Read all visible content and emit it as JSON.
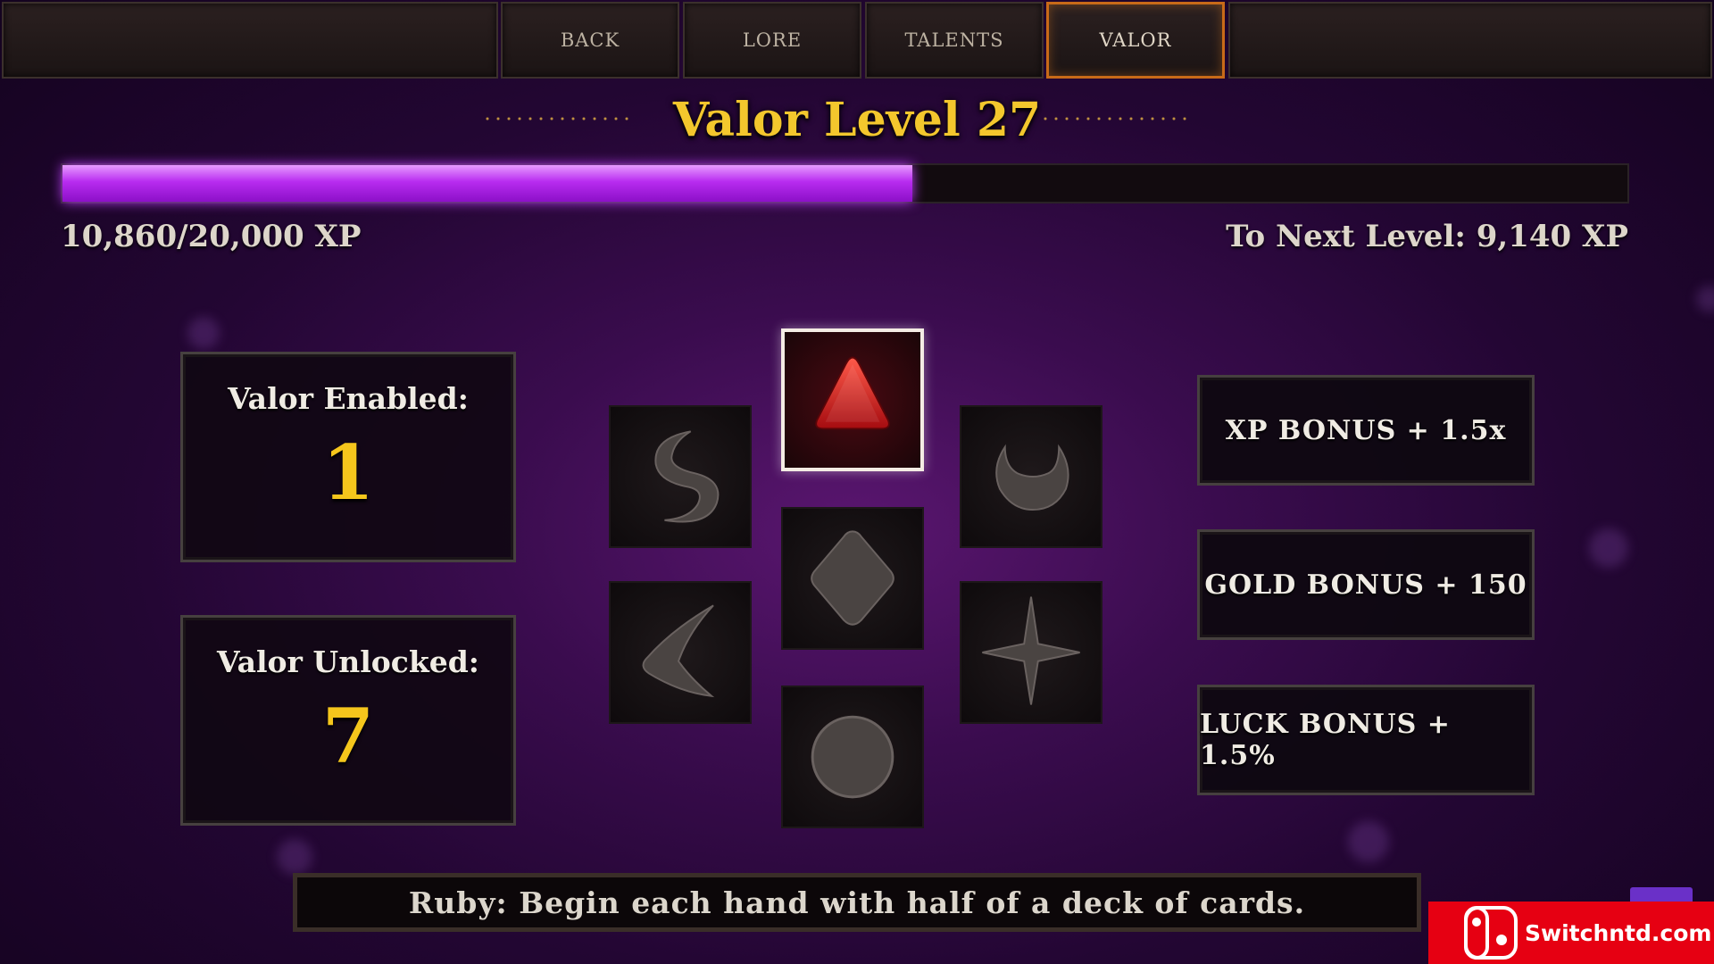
{
  "nav": {
    "tabs": [
      {
        "label": "BACK",
        "active": false
      },
      {
        "label": "LORE",
        "active": false
      },
      {
        "label": "TALENTS",
        "active": false
      },
      {
        "label": "VALOR",
        "active": true
      }
    ]
  },
  "header": {
    "title": "Valor Level 27"
  },
  "xp": {
    "progress_text": "10,860/20,000 XP",
    "to_next_text": "To Next Level: 9,140 XP",
    "current": 10860,
    "max": 20000
  },
  "stats": {
    "enabled_label": "Valor Enabled:",
    "enabled_value": "1",
    "unlocked_label": "Valor Unlocked:",
    "unlocked_value": "7"
  },
  "gems": [
    {
      "name": "ruby",
      "icon": "red-triangle-gem-icon",
      "selected": true
    },
    {
      "name": "crescent-s",
      "icon": "s-crescent-gem-icon",
      "selected": false
    },
    {
      "name": "horn",
      "icon": "horned-crescent-gem-icon",
      "selected": false
    },
    {
      "name": "diamond",
      "icon": "diamond-gem-icon",
      "selected": false
    },
    {
      "name": "chevron",
      "icon": "chevron-gem-icon",
      "selected": false
    },
    {
      "name": "star",
      "icon": "four-point-star-gem-icon",
      "selected": false
    },
    {
      "name": "circle",
      "icon": "circle-gem-icon",
      "selected": false
    }
  ],
  "bonuses": {
    "xp": "XP BONUS + 1.5x",
    "gold": "GOLD BONUS + 150",
    "luck": "LUCK BONUS + 1.5%"
  },
  "description": "Ruby: Begin each hand with half of a deck of cards.",
  "watermark": {
    "text": "Switchntd.com"
  },
  "colors": {
    "accent_gold": "#f3c72d",
    "xp_purple": "#b82cf0",
    "active_tab": "#c86a18",
    "watermark_red": "#e60012"
  }
}
